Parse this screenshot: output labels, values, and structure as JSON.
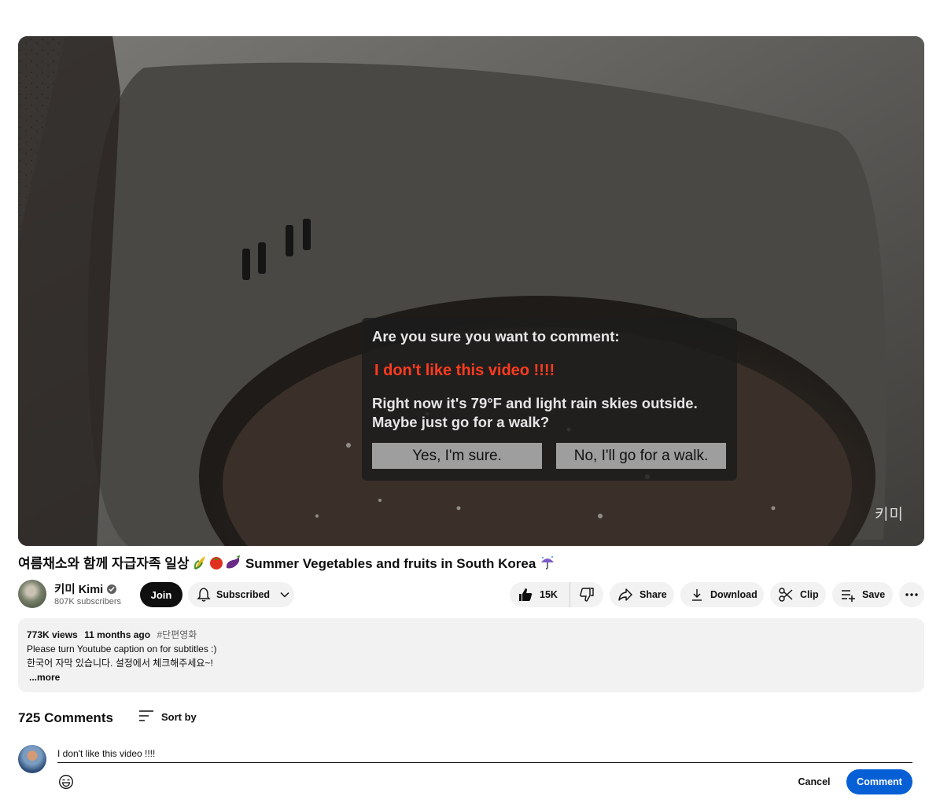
{
  "video": {
    "watermark": "키미",
    "dialog": {
      "question": "Are you sure you want to comment:",
      "quoted_comment": "I don't like this video !!!!",
      "weather_line1": "Right now it's 79°F and light rain skies outside.",
      "weather_line2": "Maybe just go for a walk?",
      "confirm_label": "Yes, I'm sure.",
      "decline_label": "No, I'll go for a walk."
    }
  },
  "title": {
    "korean": "여름채소와 함께 자급자족 일상",
    "english": "Summer Vegetables and fruits in South Korea",
    "emoji_icons": [
      "corn-icon",
      "tomato-icon",
      "eggplant-icon",
      "umbrella-rain-icon"
    ]
  },
  "channel": {
    "name": "키미 Kimi",
    "subscribers": "807K subscribers",
    "join_label": "Join",
    "subscribed_label": "Subscribed"
  },
  "actions": {
    "likes": "15K",
    "share_label": "Share",
    "download_label": "Download",
    "clip_label": "Clip",
    "save_label": "Save"
  },
  "description": {
    "views": "773K views",
    "age": "11 months ago",
    "hashtag": "#단편영화",
    "line1": "Please turn Youtube caption on for subtitles :)",
    "line2": "한국어 자막 있습니다. 설정에서 체크해주세요~!",
    "more_label": "...more"
  },
  "comments": {
    "count_label": "725 Comments",
    "sort_label": "Sort by",
    "draft": "I don't like this video !!!!",
    "cancel_label": "Cancel",
    "submit_label": "Comment"
  },
  "colors": {
    "accent": "#065fd4",
    "warning_text": "#ff3b1f",
    "pill_bg": "#f2f2f2"
  }
}
